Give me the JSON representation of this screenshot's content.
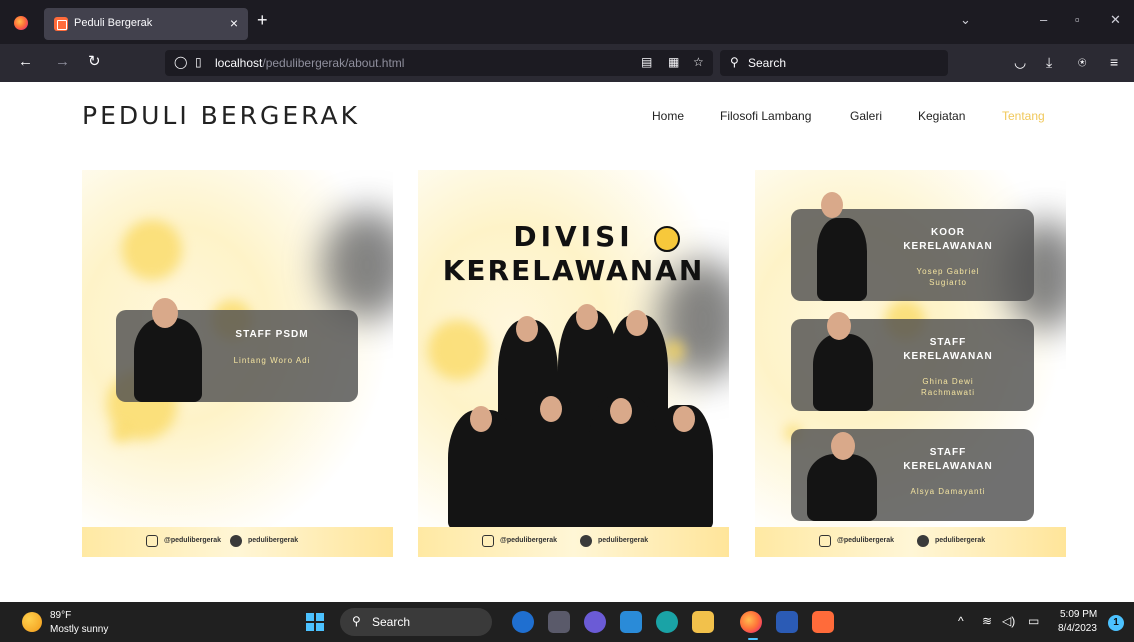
{
  "browser": {
    "tab_title": "Peduli Bergerak",
    "url_host": "localhost",
    "url_path": "/pedulibergerak/about.html",
    "search_placeholder": "Search"
  },
  "site": {
    "brand": "PEDULI BERGERAK",
    "menu": [
      "Home",
      "Filosofi Lambang",
      "Galeri",
      "Kegiatan",
      "Tentang"
    ],
    "active_menu": "Tentang"
  },
  "cards": {
    "left": {
      "title": "STAFF PSDM",
      "name": "Lintang Woro Adi",
      "footer_instagram": "@pedulibergerak",
      "footer_handle": "pedulibergerak"
    },
    "center": {
      "title_line1": "DIVISI",
      "title_line2": "KERELAWANAN",
      "footer_instagram": "@pedulibergerak",
      "footer_handle": "pedulibergerak"
    },
    "right": {
      "members": [
        {
          "title_line1": "KOOR",
          "title_line2": "KERELAWANAN",
          "name_line1": "Yosep Gabriel",
          "name_line2": "Sugiarto"
        },
        {
          "title_line1": "STAFF",
          "title_line2": "KERELAWANAN",
          "name_line1": "Ghina Dewi",
          "name_line2": "Rachmawati"
        },
        {
          "title_line1": "STAFF",
          "title_line2": "KERELAWANAN",
          "name_line1": "Alsya Damayanti",
          "name_line2": ""
        }
      ],
      "footer_instagram": "@pedulibergerak",
      "footer_handle": "pedulibergerak"
    }
  },
  "taskbar": {
    "temperature": "89°F",
    "weather": "Mostly sunny",
    "search_label": "Search",
    "time": "5:09 PM",
    "date": "8/4/2023",
    "notifications": "1"
  },
  "colors": {
    "accent_yellow": "#f0c85a",
    "browser_dark": "#1c1b22",
    "taskbar": "#202020"
  }
}
